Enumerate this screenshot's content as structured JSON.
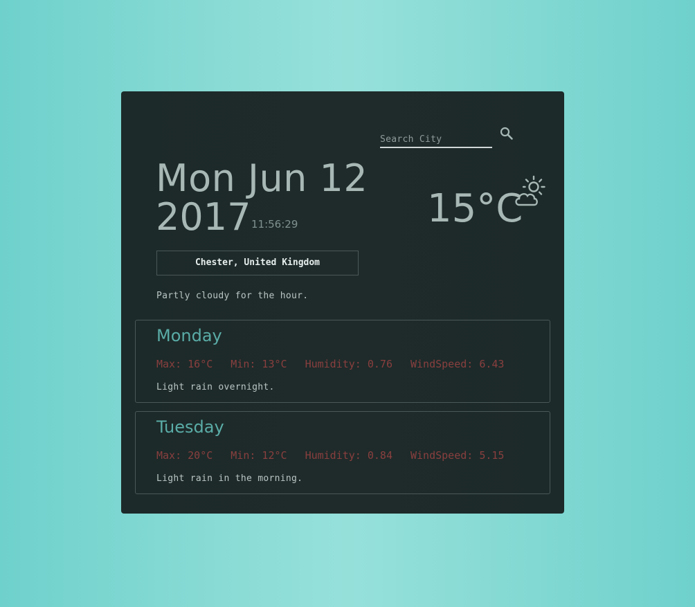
{
  "search": {
    "placeholder": "Search City",
    "icon": "search-icon"
  },
  "current": {
    "date_line1": "Mon Jun 12",
    "date_line2": "2017",
    "time": "11:56:29",
    "temperature": "15°C",
    "icon": "partly-cloudy-day-icon",
    "location": "Chester, United Kingdom",
    "summary": "Partly cloudy for the hour."
  },
  "forecast": [
    {
      "day": "Monday",
      "max": "Max: 16°C",
      "min": "Min: 13°C",
      "humidity": "Humidity: 0.76",
      "windspeed": "WindSpeed: 6.43",
      "summary": "Light rain overnight."
    },
    {
      "day": "Tuesday",
      "max": "Max: 20°C",
      "min": "Min: 12°C",
      "humidity": "Humidity: 0.84",
      "windspeed": "WindSpeed: 5.15",
      "summary": "Light rain in the morning."
    }
  ],
  "colors": {
    "background": "#7fd6d0",
    "card": "#1d2a29",
    "primary_text": "#a7b8b5",
    "day_name": "#5aaca7",
    "stats": "#8a3f3f"
  }
}
